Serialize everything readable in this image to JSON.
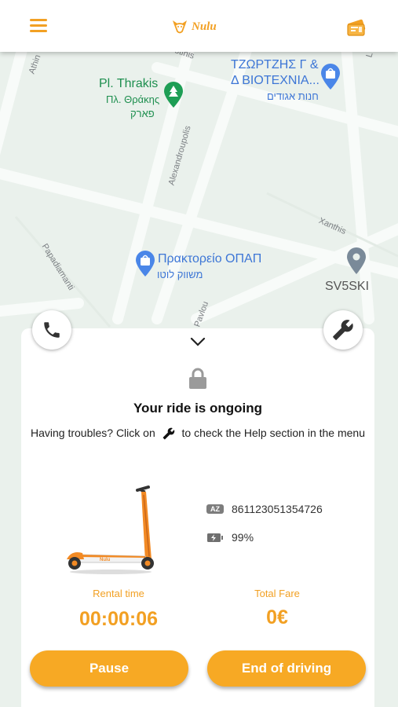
{
  "header": {
    "logo_text": "Nulu",
    "menu_icon": "hamburger-menu-icon",
    "ticket_icon": "ticket-icon",
    "accent_color": "#f2a023"
  },
  "map": {
    "places": [
      {
        "name": "Pl. Thrakis",
        "sub1": "Πλ. Θράκης",
        "sub2": "פארק",
        "icon": "park-tree-icon"
      },
      {
        "name": "ΤΖΩΡΤΖΗΣ Γ &",
        "sub1": "Δ ΒΙΟΤΕΧΝΙΑ...",
        "sub2": "חנות אגודים",
        "icon": "shopping-bag-pin-icon"
      },
      {
        "name": "Πρακτορείο ΟΠΑΠ",
        "sub1": "משווק לוטו",
        "icon": "shopping-bag-pin-icon"
      },
      {
        "name": "SV5SKI",
        "icon": "location-pin-icon"
      }
    ],
    "streets": [
      "Athin",
      "otinis",
      "Alexandroupolis",
      "Xanthis",
      "Papadiamanti",
      "Pavlou",
      "L"
    ]
  },
  "buttons": {
    "call_icon": "phone-icon",
    "help_icon": "wrench-icon"
  },
  "ride": {
    "collapse_icon": "chevron-down-icon",
    "lock_icon": "lock-icon",
    "title": "Your ride is ongoing",
    "help_prefix": "Having troubles? Click on",
    "help_suffix": "to check the Help section in the menu",
    "scooter_id_badge": "AZ",
    "scooter_id": "861123051354726",
    "battery": "99%",
    "rental_time_label": "Rental time",
    "rental_time": "00:00:06",
    "total_fare_label": "Total Fare",
    "total_fare": "0€",
    "pause_label": "Pause",
    "end_label": "End of driving"
  }
}
